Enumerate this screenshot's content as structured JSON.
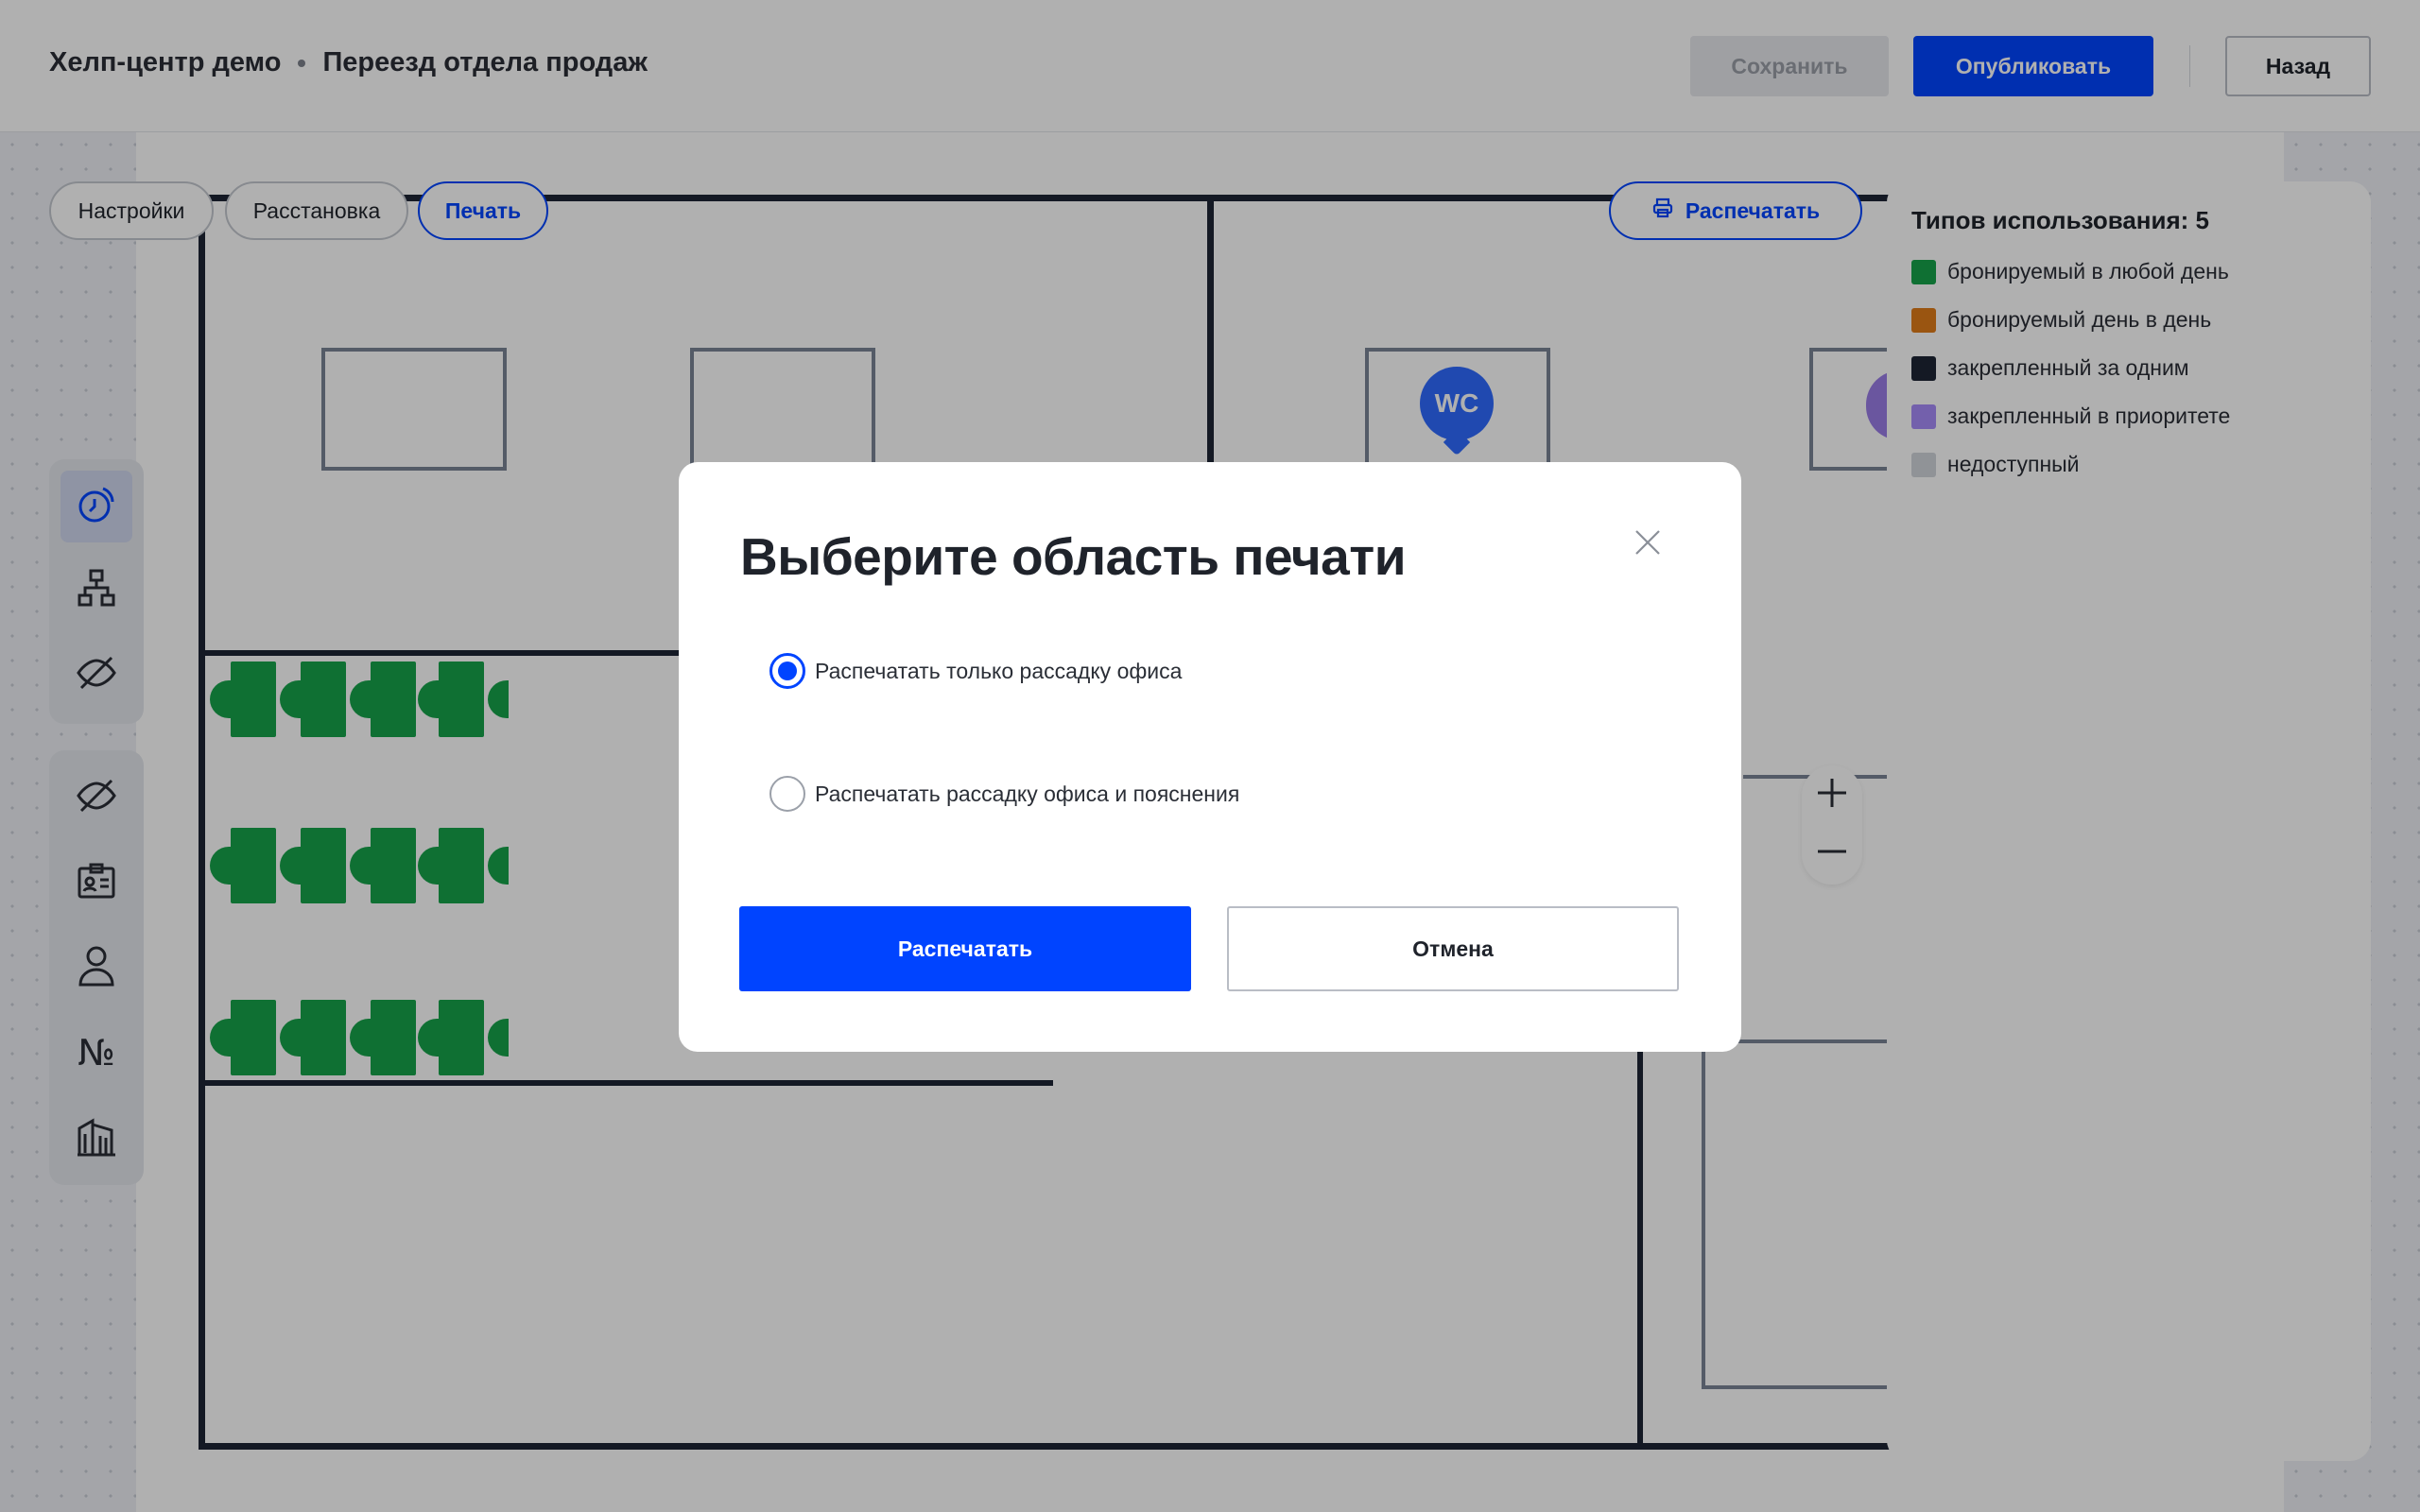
{
  "header": {
    "breadcrumb": [
      "Хелп-центр демо",
      "Переезд отдела продаж"
    ],
    "save_label": "Сохранить",
    "publish_label": "Опубликовать",
    "back_label": "Назад"
  },
  "tabs": [
    {
      "label": "Настройки",
      "active": false
    },
    {
      "label": "Расстановка",
      "active": false
    },
    {
      "label": "Печать",
      "active": true
    }
  ],
  "print_button": {
    "label": "Распечатать",
    "icon": "printer-icon"
  },
  "map": {
    "wc_label": "WC"
  },
  "toolbar": {
    "group1": [
      "clock-swap-icon",
      "org-chart-icon",
      "hide-icon"
    ],
    "group2": [
      "hide-icon",
      "badge-icon",
      "person-icon",
      "numero-icon",
      "building-icon"
    ],
    "numero_symbol": "№"
  },
  "zoom": {
    "in_icon": "plus-icon",
    "out_icon": "minus-icon"
  },
  "legend": {
    "title": "Типов использования: 5",
    "items": [
      {
        "label": "бронируемый в любой день",
        "color": "#16a34a"
      },
      {
        "label": "бронируемый день в день",
        "color": "#e07b1a"
      },
      {
        "label": "закрепленный за одним",
        "color": "#1d2535"
      },
      {
        "label": "закрепленный в приоритете",
        "color": "#a78bfa"
      },
      {
        "label": "недоступный",
        "color": "#d1d5db"
      }
    ]
  },
  "dialog": {
    "title": "Выберите область печати",
    "options": [
      {
        "label": "Распечатать только рассадку офиса",
        "selected": true
      },
      {
        "label": "Распечатать рассадку офиса и пояснения",
        "selected": false
      }
    ],
    "confirm_label": "Распечатать",
    "cancel_label": "Отмена"
  },
  "colors": {
    "accent": "#0044ff",
    "desk": "#16a34a",
    "wall": "#1d2535"
  }
}
